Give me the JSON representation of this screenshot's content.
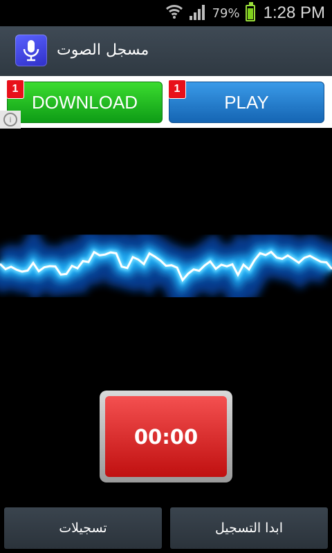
{
  "status_bar": {
    "battery_percent": "79%",
    "time": "1:28 PM",
    "icons": [
      "wifi-icon",
      "signal-icon",
      "battery-icon"
    ],
    "battery_level": 0.79
  },
  "app_bar": {
    "title": "مسجل الصوت",
    "icon": "microphone-icon"
  },
  "ad": {
    "download_label": "DOWNLOAD",
    "play_label": "PLAY",
    "download_badge": "1",
    "play_badge": "1",
    "info_icon": "info-icon",
    "colors": {
      "download": "#1fb824",
      "play": "#1f7bd0",
      "badge": "#e8101a"
    }
  },
  "recorder": {
    "timer": "00:00",
    "waveform_color": "#39c6ff"
  },
  "bottom": {
    "recordings_label": "تسجيلات",
    "start_label": "ابدا التسجيل"
  }
}
